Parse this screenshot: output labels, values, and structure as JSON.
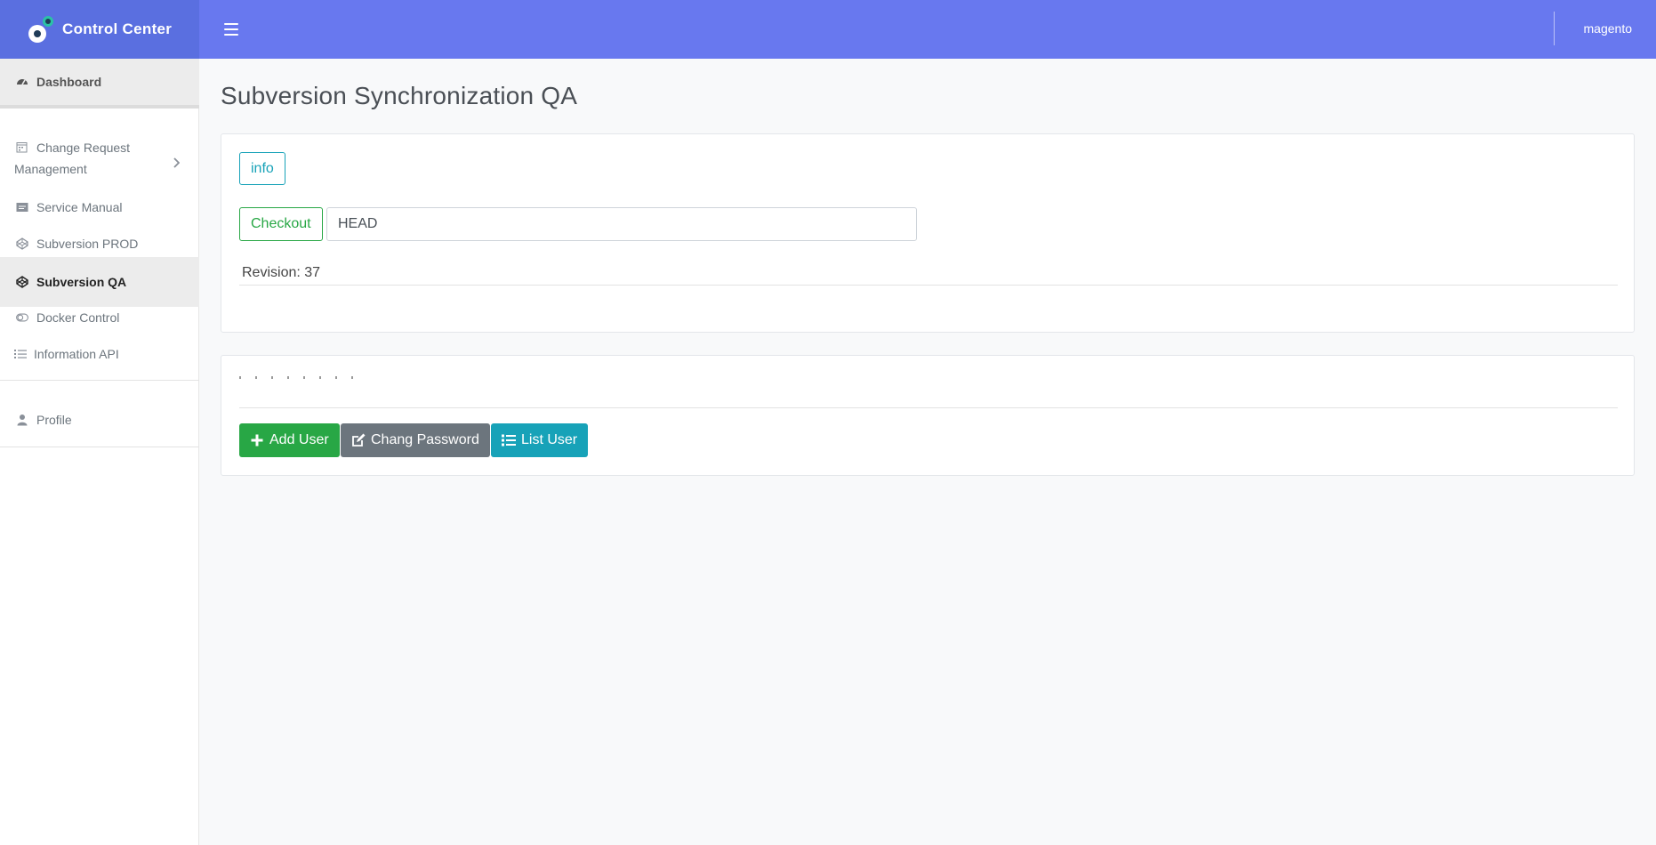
{
  "header": {
    "brand_title": "Control Center",
    "user_name": "magento",
    "colors": {
      "brand_bg": "#5a6fe0",
      "navbar_bg": "#6878ef"
    }
  },
  "sidebar": {
    "dashboard": "Dashboard",
    "change_request_line1": "Change Request",
    "change_request_line2": "Management",
    "service_manual": "Service Manual",
    "svn_prod": "Subversion PROD",
    "svn_qa": "Subversion QA",
    "docker_control": "Docker Control",
    "information_api": "Information API",
    "profile": "Profile",
    "active_item": "Subversion QA"
  },
  "main": {
    "page_title": "Subversion Synchronization QA",
    "info_button": "info",
    "checkout_button": "Checkout",
    "revision_input_value": "HEAD",
    "revision_text": "Revision: 37",
    "add_user_button": "Add User",
    "change_password_button": "Chang Password",
    "list_user_button": "List User"
  }
}
